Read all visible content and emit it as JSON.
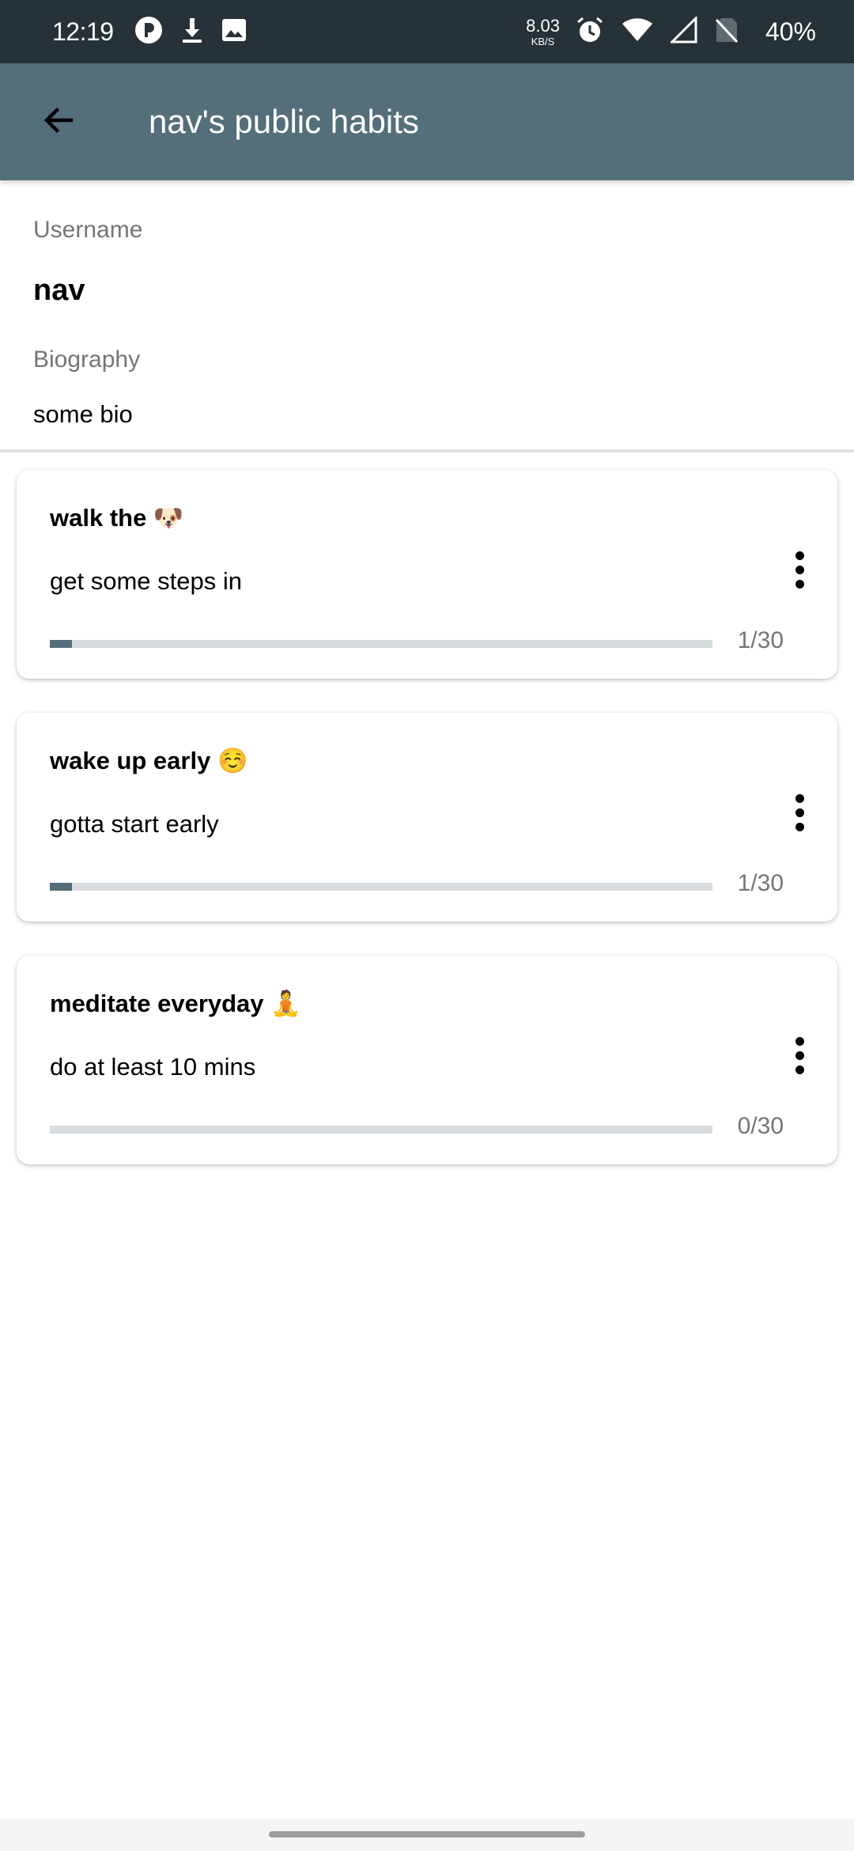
{
  "status_bar": {
    "time": "12:19",
    "net_speed": "8.03",
    "net_unit": "KB/S",
    "battery": "40%"
  },
  "app_bar": {
    "title": "nav's public habits",
    "back_icon": "arrow-back-icon"
  },
  "profile": {
    "username_label": "Username",
    "username": "nav",
    "bio_label": "Biography",
    "bio": "some bio"
  },
  "habits": [
    {
      "title": "walk the 🐶",
      "description": "get some steps in",
      "progress_text": "1/30",
      "done": 1,
      "total": 30
    },
    {
      "title": "wake up early ☺️",
      "description": "gotta start early",
      "progress_text": "1/30",
      "done": 1,
      "total": 30
    },
    {
      "title": "meditate everyday 🧘",
      "description": "do at least 10 mins",
      "progress_text": "0/30",
      "done": 0,
      "total": 30
    }
  ],
  "colors": {
    "status_bar": "#263238",
    "app_bar": "#546e7a",
    "progress_fill": "#546e7a",
    "progress_track": "#d6dbde"
  }
}
